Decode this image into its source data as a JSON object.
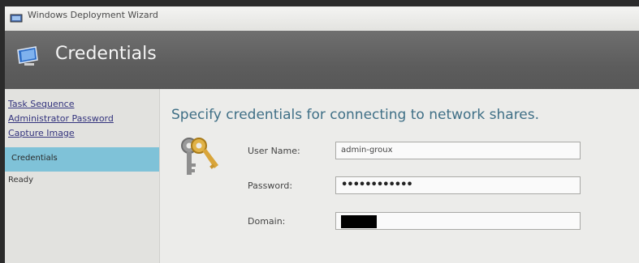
{
  "window": {
    "title": "Windows Deployment Wizard"
  },
  "banner": {
    "title": "Credentials",
    "icon": "monitor-icon"
  },
  "sidebar": {
    "items": [
      {
        "label": "Task Sequence",
        "state": "completed"
      },
      {
        "label": "Administrator Password",
        "state": "completed"
      },
      {
        "label": "Capture Image",
        "state": "completed"
      },
      {
        "label": "Credentials",
        "state": "active"
      },
      {
        "label": "Ready",
        "state": "pending"
      }
    ]
  },
  "main": {
    "heading": "Specify credentials for connecting to network shares.",
    "icon": "key-icon",
    "fields": {
      "username": {
        "label": "User Name:",
        "value": "admin-groux"
      },
      "password": {
        "label": "Password:",
        "value": "••••••••••••"
      },
      "domain": {
        "label": "Domain:",
        "value": ""
      }
    }
  },
  "colors": {
    "banner_bg": "#5f5f5f",
    "active_nav_bg": "#7fc2d8",
    "heading_text": "#3f6f86",
    "link_text": "#33337d"
  }
}
